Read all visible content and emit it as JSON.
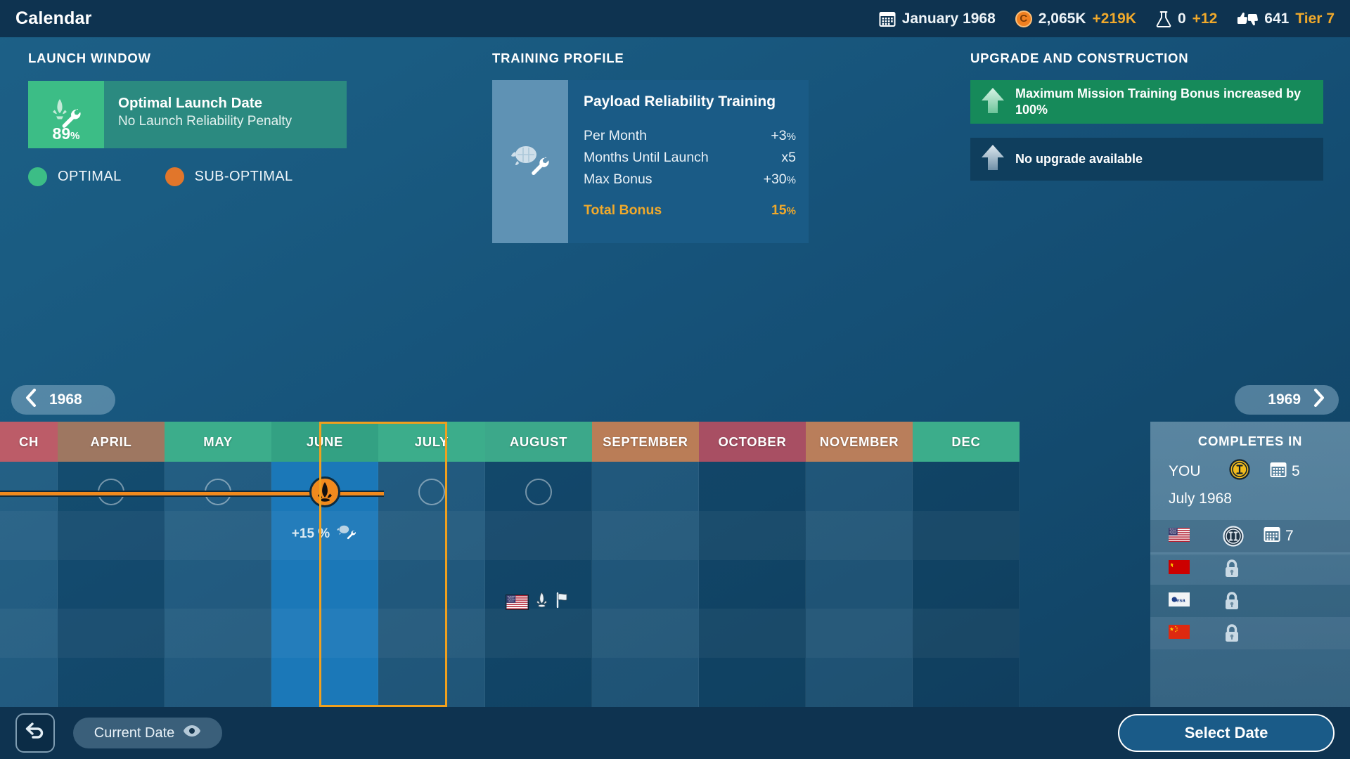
{
  "header": {
    "title": "Calendar",
    "date_icon": "calendar-icon",
    "date": "January 1968",
    "funds_icon": "coin-icon",
    "funds": "2,065K",
    "funds_delta": "+219K",
    "science_icon": "flask-icon",
    "science": "0",
    "science_delta": "+12",
    "reputation_icon": "thumbs-icon",
    "reputation": "641",
    "reputation_tier": "Tier 7"
  },
  "launch_window": {
    "title": "LAUNCH WINDOW",
    "badge_icon": "rocket-wrench-icon",
    "percent": "89",
    "percent_unit": "%",
    "headline": "Optimal Launch Date",
    "subline": "No Launch Reliability Penalty",
    "legend": [
      {
        "label": "OPTIMAL",
        "color": "#3cbd86"
      },
      {
        "label": "SUB-OPTIMAL",
        "color": "#e1762b"
      }
    ]
  },
  "training_profile": {
    "title": "TRAINING PROFILE",
    "thumb_icon": "capsule-wrench-icon",
    "name": "Payload Reliability Training",
    "rows": [
      {
        "label": "Per Month",
        "value": "+3",
        "unit": "%"
      },
      {
        "label": "Months Until Launch",
        "value": "x5",
        "unit": ""
      },
      {
        "label": "Max Bonus",
        "value": "+30",
        "unit": "%"
      }
    ],
    "total_label": "Total Bonus",
    "total_value": "15",
    "total_unit": "%",
    "accent": "#f0a92b"
  },
  "upgrade_construction": {
    "title": "UPGRADE AND CONSTRUCTION",
    "items": [
      {
        "icon": "arrow-up-icon",
        "text": "Maximum Mission Training Bonus increased by 100%",
        "state": "active",
        "color": "#168a5a"
      },
      {
        "icon": "arrow-up-icon",
        "text": "No upgrade available",
        "state": "inactive",
        "color": "#0f3e5d"
      }
    ]
  },
  "timeline": {
    "prev_year": "1968",
    "next_year": "1969",
    "prev_icon": "chevron-left-icon",
    "next_icon": "chevron-right-icon",
    "selected_month": "JUNE",
    "months": [
      {
        "label": "CH",
        "color": "#bc5c68",
        "partial": true
      },
      {
        "label": "APRIL",
        "color": "#9e7761"
      },
      {
        "label": "MAY",
        "color": "#3cad8b"
      },
      {
        "label": "JUNE",
        "color": "#33a183"
      },
      {
        "label": "JULY",
        "color": "#3cad8b"
      },
      {
        "label": "AUGUST",
        "color": "#3ca88a"
      },
      {
        "label": "SEPTEMBER",
        "color": "#ba7d57"
      },
      {
        "label": "OCTOBER",
        "color": "#a84f63"
      },
      {
        "label": "NOVEMBER",
        "color": "#b97e5b"
      },
      {
        "label": "DEC",
        "color": "#3cad8b",
        "partial": true
      }
    ],
    "launch_marker": {
      "month": "JUNE",
      "icon": "rocket-marker-icon",
      "color": "#f08a1e"
    },
    "bonus_tag": {
      "month": "JUNE",
      "text": "+15 %",
      "icon": "capsule-wrench-icon"
    },
    "empty_slots": [
      "APRIL",
      "MAY",
      "JULY",
      "AUGUST"
    ],
    "event_tag": {
      "month": "AUGUST",
      "flag": "us-flag-icon",
      "icons": [
        "rocket-icon",
        "flag-icon"
      ]
    }
  },
  "completes_in": {
    "title": "COMPLETES IN",
    "you": {
      "label": "YOU",
      "badge_icon": "roman-one-badge-icon",
      "calendar_icon": "calendar-icon",
      "months": "5",
      "date": "July 1968"
    },
    "rivals": [
      {
        "flag": "us-flag-icon",
        "badge_icon": "roman-two-badge-icon",
        "calendar_icon": "calendar-icon",
        "months": "7",
        "locked": false
      },
      {
        "flag": "ussr-flag-icon",
        "badge_icon": "lock-icon",
        "locked": true
      },
      {
        "flag": "esa-flag-icon",
        "badge_icon": "lock-icon",
        "locked": true
      },
      {
        "flag": "china-flag-icon",
        "badge_icon": "lock-icon",
        "locked": true
      }
    ]
  },
  "bottom_bar": {
    "back_icon": "back-arrow-icon",
    "current_date_label": "Current Date",
    "current_date_icon": "eye-icon",
    "select_date_label": "Select Date"
  }
}
